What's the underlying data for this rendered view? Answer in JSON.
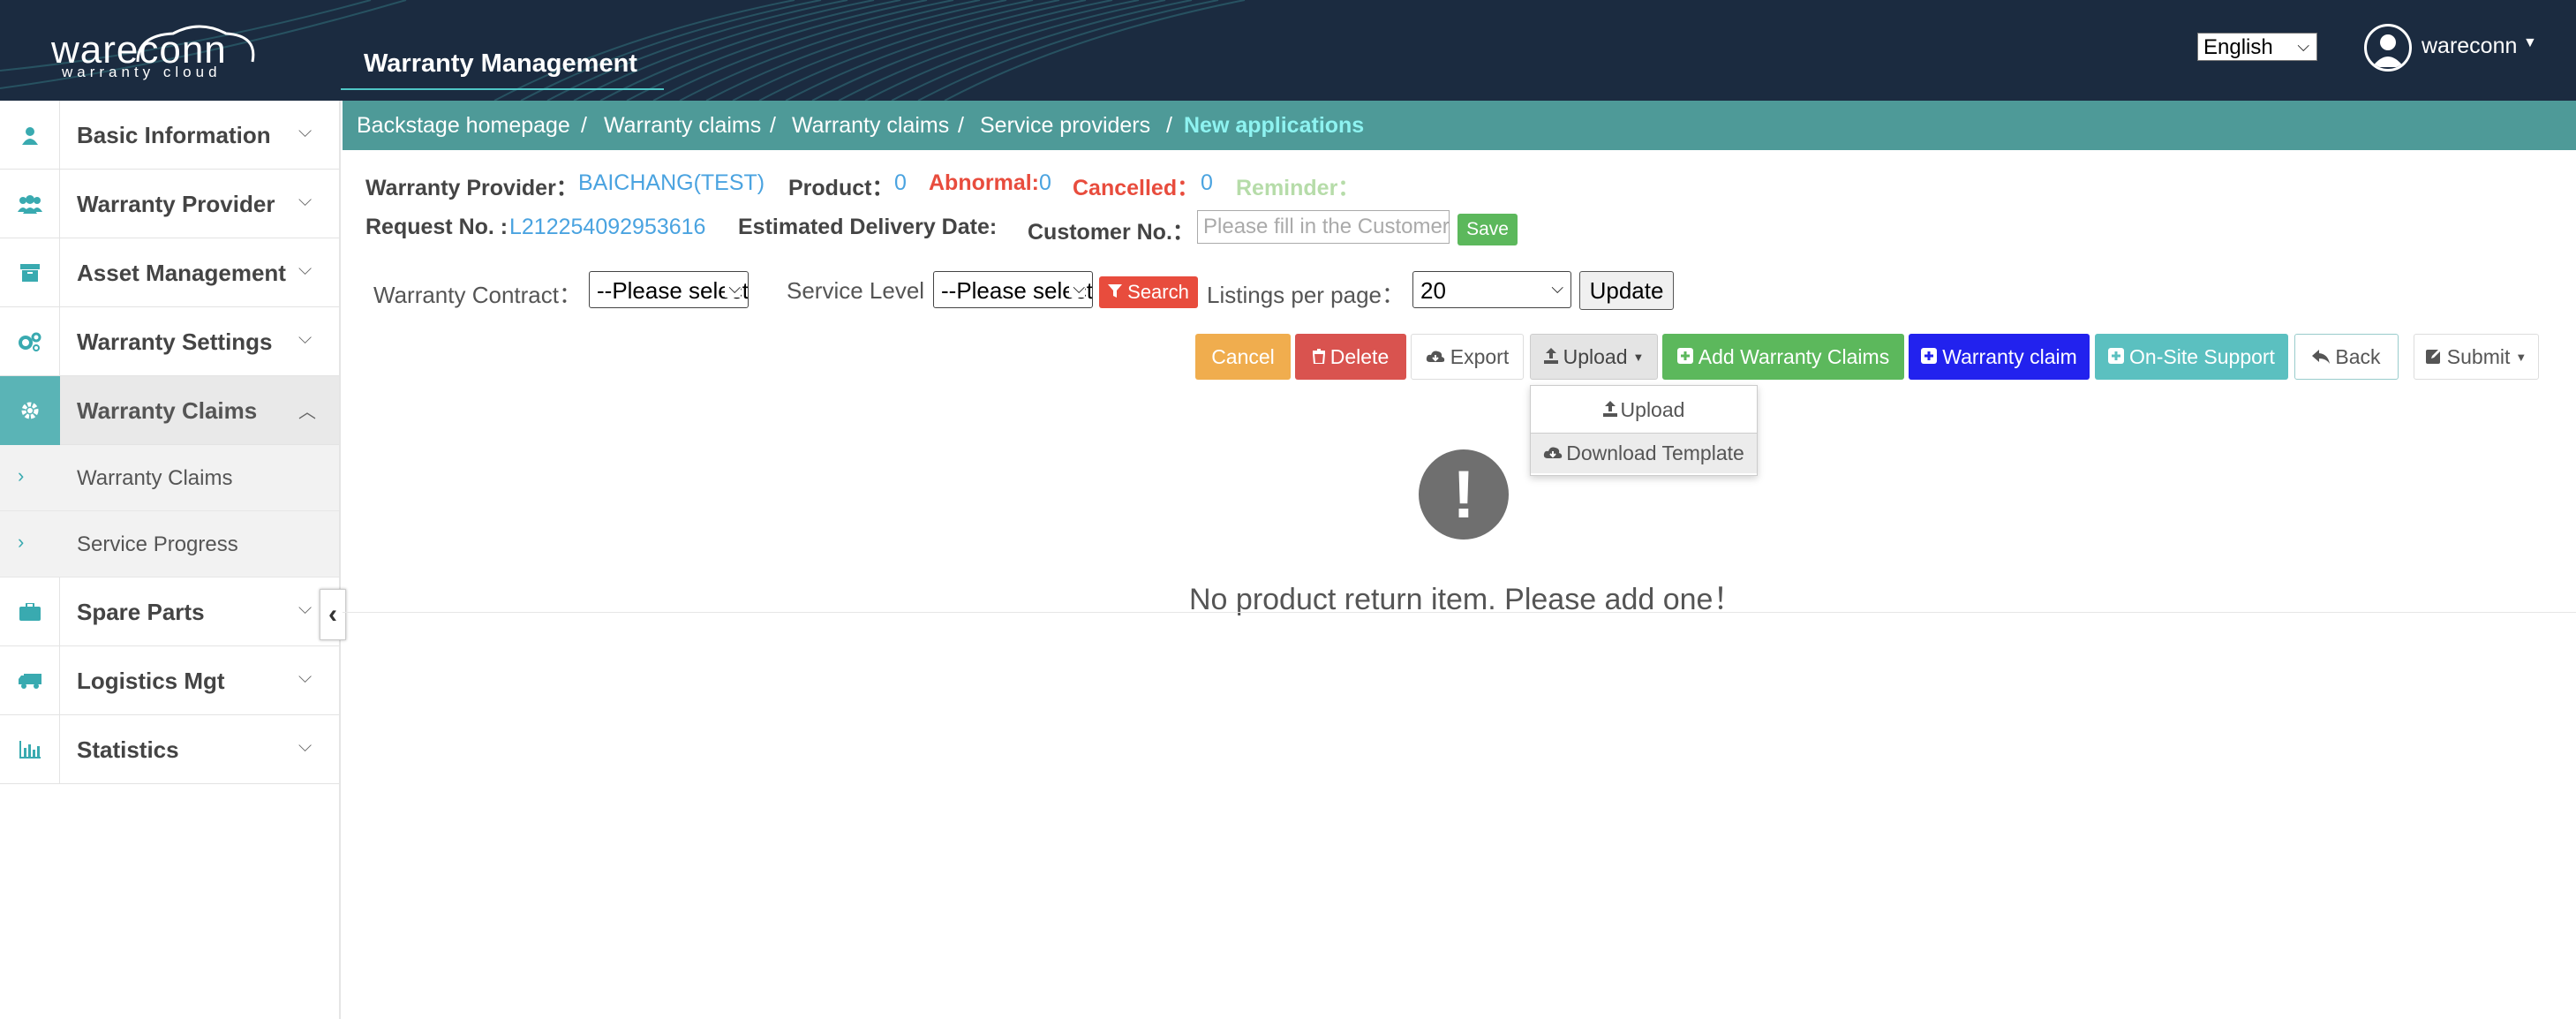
{
  "header": {
    "logo_word": "wareconn",
    "logo_sub": "warranty cloud",
    "app_title": "Warranty Management",
    "language": "English",
    "user_name": "wareconn"
  },
  "sidebar": {
    "items": [
      {
        "label": "Basic Information",
        "icon": "user-icon"
      },
      {
        "label": "Warranty Provider",
        "icon": "users-icon"
      },
      {
        "label": "Asset Management",
        "icon": "archive-icon"
      },
      {
        "label": "Warranty Settings",
        "icon": "cogs-icon"
      },
      {
        "label": "Warranty Claims",
        "icon": "gear-icon",
        "active": true,
        "children": [
          {
            "label": "Warranty Claims"
          },
          {
            "label": "Service Progress"
          }
        ]
      },
      {
        "label": "Spare Parts",
        "icon": "briefcase-icon"
      },
      {
        "label": "Logistics Mgt",
        "icon": "truck-icon"
      },
      {
        "label": "Statistics",
        "icon": "bar-chart-icon"
      }
    ]
  },
  "breadcrumb": [
    "Backstage homepage",
    "Warranty claims",
    "Warranty claims",
    "Service providers",
    "New applications"
  ],
  "info": {
    "provider_label": "Warranty Provider：",
    "provider_value": "BAICHANG(TEST)",
    "product_label": "Product：",
    "product_value": "0",
    "abnormal_label": "Abnormal:",
    "abnormal_value": "0",
    "cancelled_label": "Cancelled：",
    "cancelled_value": "0",
    "reminder_label": "Reminder：",
    "request_label": "Request No. :",
    "request_value": "L212254092953616",
    "delivery_label": "Estimated Delivery Date:",
    "customer_label": "Customer No.：",
    "customer_placeholder": "Please fill in the Customer No.",
    "save_label": "Save"
  },
  "filters": {
    "contract_label": "Warranty Contract：",
    "contract_value": "--Please select--",
    "service_label": "Service Level",
    "service_value": "--Please select--",
    "search_label": "Search",
    "listings_label": "Listings per page：",
    "listings_value": "20",
    "update_label": "Update"
  },
  "actions": {
    "cancel": "Cancel",
    "delete": "Delete",
    "export": "Export",
    "upload": "Upload",
    "add_claims": "Add Warranty Claims",
    "warranty_claim": "Warranty claim",
    "onsite": "On-Site Support",
    "back": "Back",
    "submit": "Submit"
  },
  "upload_menu": {
    "upload": "Upload",
    "download_template": "Download Template"
  },
  "empty": {
    "message": "No product return item. Please add one！"
  },
  "colors": {
    "header_bg": "#1b2b40",
    "accent_teal": "#4e9a98",
    "cancel": "#f0ad4e",
    "delete": "#d9534f",
    "add_claims": "#5cb85c",
    "warranty_claim": "#2222ee",
    "onsite": "#5bc0c0"
  }
}
